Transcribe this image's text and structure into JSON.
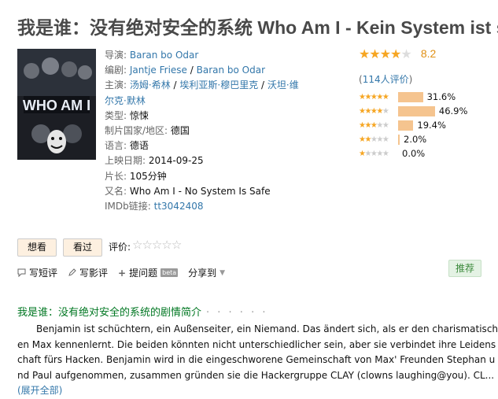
{
  "title": "我是谁：没有绝对安全的系统 Who Am I - Kein System ist sicher",
  "poster": {
    "text": "WHO AM I",
    "bg": "#1c1e24",
    "accent": "#d7dde8"
  },
  "info": {
    "director_label": "导演:",
    "director": "Baran bo Odar",
    "writer_label": "编剧:",
    "writers": [
      "Jantje Friese",
      "Baran bo Odar"
    ],
    "cast_label": "主演:",
    "cast": [
      "汤姆·希林",
      "埃利亚斯·穆巴里克",
      "沃坦·维尔克·默林"
    ],
    "cast_line1": "汤姆·希林 / 埃利亚斯·穆巴里克 / 沃坦·维",
    "cast_line2": "尔克·默林",
    "sep": " / ",
    "genre_label": "类型:",
    "genre": "惊悚",
    "country_label": "制片国家/地区:",
    "country": "德国",
    "language_label": "语言:",
    "language": "德语",
    "release_label": "上映日期:",
    "release": "2014-09-25",
    "runtime_label": "片长:",
    "runtime": "105分钟",
    "aka_label": "又名:",
    "aka": "Who Am I - No System Is Safe",
    "imdb_label": "IMDb链接:",
    "imdb": "tt3042408"
  },
  "rating": {
    "score": "8.2",
    "stars": 4.0,
    "votes_open": "(",
    "votes": "114人评价",
    "votes_close": ")",
    "distribution": [
      {
        "stars": 5,
        "percent": 31.6,
        "label": "31.6%"
      },
      {
        "stars": 4,
        "percent": 46.9,
        "label": "46.9%"
      },
      {
        "stars": 3,
        "percent": 19.4,
        "label": "19.4%"
      },
      {
        "stars": 2,
        "percent": 2.0,
        "label": "2.0%"
      },
      {
        "stars": 1,
        "percent": 0.0,
        "label": "0.0%"
      }
    ]
  },
  "buttons": {
    "want": "想看",
    "seen": "看过",
    "rate_label": "评价:"
  },
  "actions": {
    "short_review": "写短评",
    "review": "写影评",
    "question": "提问题",
    "beta": "beta",
    "share": "分享到"
  },
  "recommend": "推荐",
  "summary": {
    "title": "我是谁：没有绝对安全的系统的剧情简介",
    "dots": "· · · · · ·",
    "text": "Benjamin ist schüchtern, ein Außenseiter, ein Niemand. Das ändert sich, als er den charismatischen Max kennenlernt. Die beiden könnten nicht unterschiedlicher sein, aber sie verbindet ihre Leidenschaft fürs Hacken. Benjamin wird in die eingeschworene Gemeinschaft von Max' Freunden Stephan und Paul aufgenommen, zusammen gründen sie die Hackergruppe CLAY (clowns laughing@you). CL...",
    "expand": "(展开全部)"
  },
  "colors": {
    "green": "#007722",
    "link": "#3377aa",
    "star": "#f6a623",
    "bar": "#f5c48f"
  }
}
